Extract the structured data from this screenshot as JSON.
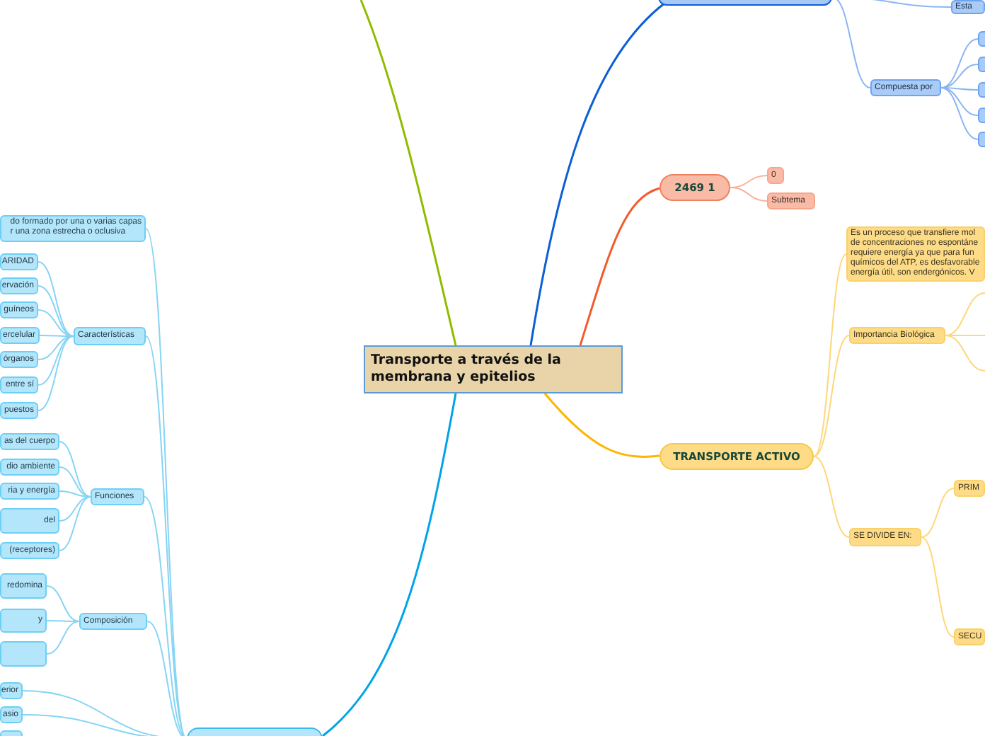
{
  "center": {
    "title": "Transporte a través de la membrana y epitelios"
  },
  "branches": [
    {
      "color": "#0b5fd6",
      "children": [
        {
          "label": "Esta"
        },
        {
          "label": "Compuesta por",
          "children": [
            {
              "kind": "box"
            },
            {
              "kind": "box"
            },
            {
              "kind": "box"
            },
            {
              "kind": "box"
            },
            {
              "kind": "box"
            }
          ]
        }
      ]
    },
    {
      "color": "#f25a2c",
      "label": "2469 1",
      "children": [
        {
          "label": "0"
        },
        {
          "label": "Subtema"
        }
      ]
    },
    {
      "color": "#ffb400",
      "label": "TRANSPORTE ACTIVO",
      "children": [
        {
          "label": "Es un proceso que transfiere mol\nde concentraciones no espontáne\nrequiere energía ya que para fun\nquímicos del ATP, es desfavorable\nenergía útil, son endergónicos. V"
        },
        {
          "label": "Importancia Biológica",
          "children": [
            {
              "kind": "stub"
            },
            {
              "kind": "stub"
            },
            {
              "kind": "stub"
            }
          ]
        },
        {
          "label": "SE DIVIDE EN:",
          "children": [
            {
              "label": "PRIM"
            },
            {
              "label": "SECU"
            }
          ]
        }
      ]
    },
    {
      "color": "#00a3e8",
      "children": [
        {
          "label": "do formado por una o varias capas\nr una zona estrecha o oclusiva"
        },
        {
          "label": "Características",
          "children": [
            {
              "label": "ARIDAD"
            },
            {
              "label": "ervación"
            },
            {
              "label": "guíneos"
            },
            {
              "label": "ercelular"
            },
            {
              "label": "órganos"
            },
            {
              "label": "entre sí"
            },
            {
              "label": "puestos"
            }
          ]
        },
        {
          "label": "Funciones",
          "children": [
            {
              "label": "as del cuerpo"
            },
            {
              "label": "dio ambiente"
            },
            {
              "label": "ria y energía"
            },
            {
              "label": "del"
            },
            {
              "label": "(receptores)"
            }
          ]
        },
        {
          "label": "Composición",
          "children": [
            {
              "label": "redomina"
            },
            {
              "label": "y"
            },
            {
              "kind": "box"
            }
          ]
        },
        {
          "label": "erior"
        },
        {
          "label": "asio"
        },
        {
          "kind": "box"
        }
      ]
    },
    {
      "color": "#8fbc00"
    }
  ]
}
